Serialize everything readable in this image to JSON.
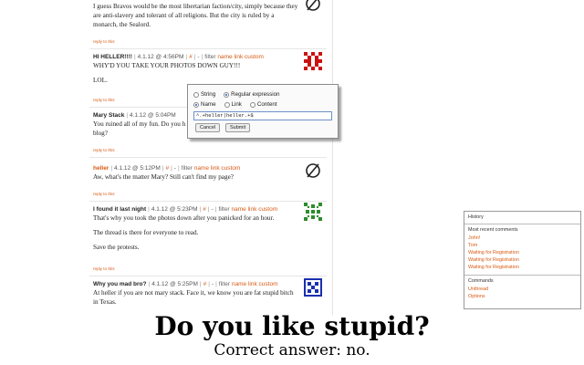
{
  "comments": [
    {
      "paragraphs": [
        "I guess Bravos would be the most libertarian faction/city, simply because they are anti-slavery and tolerant of all religions. But the city is ruled by a monarch, the Sealord."
      ],
      "reply": "reply to this"
    },
    {
      "author": "HI HELLER!!!!",
      "date": "4.1.12 @ 4:56PM",
      "paragraphs": [
        "WHY'D YOU TAKE YOUR PHOTOS DOWN GUY!!!",
        "LOL."
      ],
      "reply": "reply to this"
    },
    {
      "author": "Mary Stack",
      "date": "4.1.12 @ 5:04PM",
      "paragraphs": [
        "You ruined all of my fun. Do you h",
        "blog?"
      ],
      "reply": "reply to this"
    },
    {
      "author": "heller",
      "date": "4.1.12 @ 5:12PM",
      "paragraphs": [
        "Aw, what's the matter Mary? Still can't find my page?"
      ],
      "reply": "reply to this"
    },
    {
      "author": "I found it last night",
      "date": "4.1.12 @ 5:23PM",
      "paragraphs": [
        "That's why you took the photos down after you panicked for an hour.",
        "The thread is there for everyone to read.",
        "Save the protests."
      ],
      "reply": "reply to this"
    },
    {
      "author": "Why you mad bro?",
      "date": "4.1.12 @ 5:25PM",
      "paragraphs": [
        "At heller if you are not mary stack. Face it, we know you are fat stupid bitch in Texas."
      ]
    }
  ],
  "header_links": {
    "hash": "#",
    "dash": "-",
    "filter": "filter",
    "name": "name",
    "link": "link",
    "custom": "custom"
  },
  "dialog": {
    "opt_string": "String",
    "opt_regex": "Regular expression",
    "opt_name": "Name",
    "opt_link": "Link",
    "opt_content": "Content",
    "input_value": "^.+heller|heller.+$",
    "cancel": "Cancel",
    "submit": "Submit"
  },
  "history": {
    "title": "History",
    "recent_heading": "Most recent comments",
    "recent": [
      "John!",
      "Tom",
      "Waiting for Registration",
      "Waiting for Registration",
      "Waiting for Registration"
    ],
    "commands_heading": "Commands",
    "commands": [
      "Unthread",
      "Options"
    ]
  },
  "caption": {
    "title": "Do you like stupid?",
    "subtitle": "Correct answer: no."
  },
  "colors": {
    "link": "#d85a14",
    "avatar_red": "#cc1111",
    "avatar_green": "#2e8b2e",
    "avatar_blue": "#1a2fb0"
  }
}
